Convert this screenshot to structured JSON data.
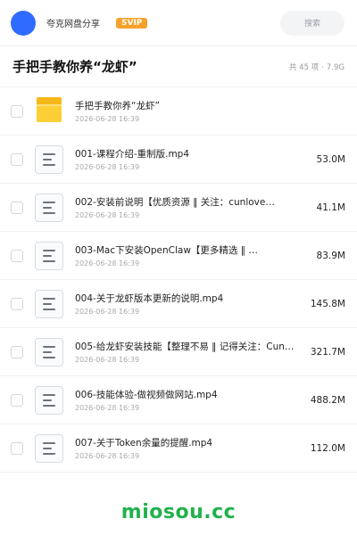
{
  "header": {
    "share_name": "夸克网盘分享",
    "badge": "SVIP",
    "search_placeholder": "搜索"
  },
  "title": "手把手教你养“龙虾”",
  "meta": {
    "count": "共 45 项",
    "size": "7.9G"
  },
  "files": [
    {
      "type": "folder",
      "name": "手把手教你养“龙虾”",
      "date": "2026-06-28 16:39",
      "size": ""
    },
    {
      "type": "file",
      "name": "001-课程介绍-重制版.mp4",
      "date": "2026-06-28 16:39",
      "size": "53.0M"
    },
    {
      "type": "file",
      "name": "002-安装前说明【优质资源 ‖ 关注：cunlove…",
      "date": "2026-06-28 16:39",
      "size": "41.1M"
    },
    {
      "type": "file",
      "name": "003-Mac下安装OpenClaw【更多精选 ‖ …",
      "date": "2026-06-28 16:39",
      "size": "83.9M"
    },
    {
      "type": "file",
      "name": "004-关于龙虾版本更新的说明.mp4",
      "date": "2026-06-28 16:39",
      "size": "145.8M"
    },
    {
      "type": "file",
      "name": "005-给龙虾安装技能【整理不易 ‖ 记得关注：Cun…",
      "date": "2026-06-28 16:39",
      "size": "321.7M"
    },
    {
      "type": "file",
      "name": "006-技能体验-做视频做网站.mp4",
      "date": "2026-06-28 16:39",
      "size": "488.2M"
    },
    {
      "type": "file",
      "name": "007-关于Token余量的提醒.mp4",
      "date": "2026-06-28 16:39",
      "size": "112.0M"
    }
  ],
  "footer": {
    "brand": "miosou.cc"
  },
  "colors": {
    "accent": "#2f6bff",
    "svip": "#f5a12a",
    "folder": "#fccf36",
    "brand": "#22b14c"
  }
}
